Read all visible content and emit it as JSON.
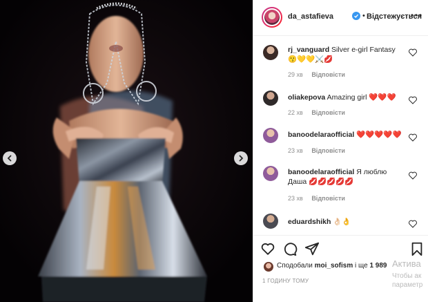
{
  "post": {
    "username": "da_astafieva",
    "separator": "•",
    "follow_label": "Відстежується"
  },
  "comments": [
    {
      "user": "rj_vanguard",
      "text": "Silver e-girl Fantasy",
      "emoji": "😗💛💛⚔️💋",
      "time": "29 хв",
      "reply": "Відповісти"
    },
    {
      "user": "oliakepova",
      "text": "Amazing girl",
      "emoji": "❤️❤️❤️",
      "time": "22 хв",
      "reply": "Відповісти"
    },
    {
      "user": "banoodelaraofficial",
      "text": "",
      "emoji": "❤️❤️❤️❤️❤️",
      "time": "23 хв",
      "reply": "Відповісти"
    },
    {
      "user": "banoodelaraofficial",
      "text": "Я люблю Даша",
      "emoji": "💋💋💋💋💋",
      "time": "23 хв",
      "reply": "Відповісти"
    },
    {
      "user": "eduardshikh",
      "text": "",
      "emoji": "👌🏻👌",
      "time": "",
      "reply": ""
    }
  ],
  "likes": {
    "prefix": "Сподобали",
    "user": "moi_sofism",
    "suffix": "і ще",
    "count": "1 989"
  },
  "timestamp": "1 ГОДИНУ ТОМУ",
  "watermark": {
    "line1": "Актива",
    "line2": "Чтобы ак",
    "line3": "параметр"
  },
  "icons": {
    "prev": "chevron-left-icon",
    "next": "chevron-right-icon",
    "more": "more-horizontal-icon",
    "like": "heart-icon",
    "comment": "comment-icon",
    "share": "send-icon",
    "save": "bookmark-icon"
  }
}
